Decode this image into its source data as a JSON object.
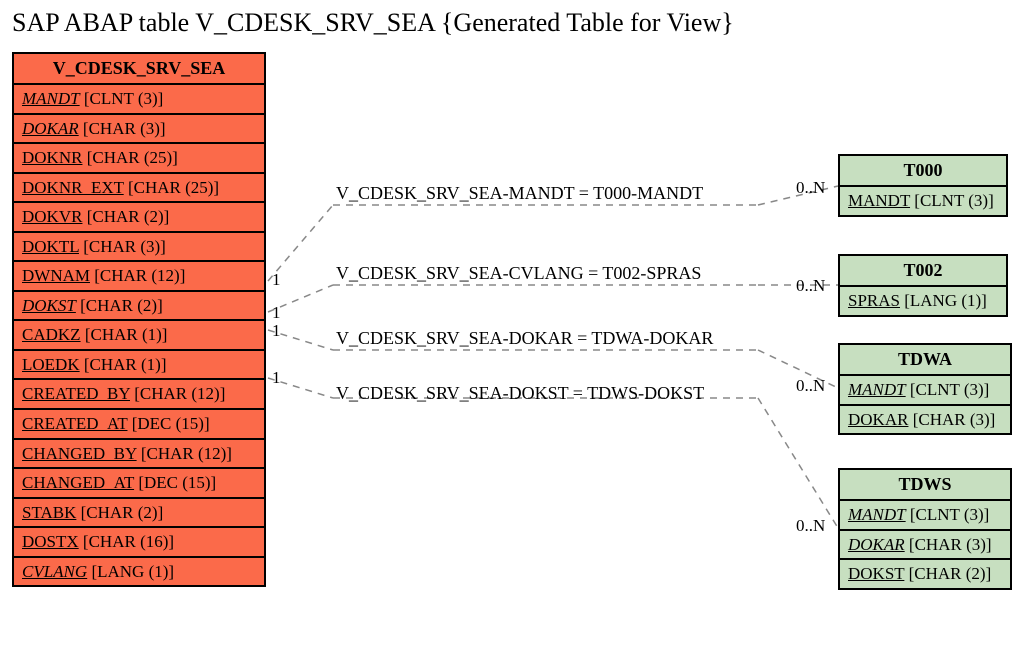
{
  "title": "SAP ABAP table V_CDESK_SRV_SEA {Generated Table for View}",
  "main_entity": {
    "name": "V_CDESK_SRV_SEA",
    "fields": [
      {
        "name": "MANDT",
        "type": "[CLNT (3)]",
        "key": true
      },
      {
        "name": "DOKAR",
        "type": "[CHAR (3)]",
        "key": true
      },
      {
        "name": "DOKNR",
        "type": "[CHAR (25)]",
        "key": false
      },
      {
        "name": "DOKNR_EXT",
        "type": "[CHAR (25)]",
        "key": false
      },
      {
        "name": "DOKVR",
        "type": "[CHAR (2)]",
        "key": false
      },
      {
        "name": "DOKTL",
        "type": "[CHAR (3)]",
        "key": false
      },
      {
        "name": "DWNAM",
        "type": "[CHAR (12)]",
        "key": false
      },
      {
        "name": "DOKST",
        "type": "[CHAR (2)]",
        "key": true
      },
      {
        "name": "CADKZ",
        "type": "[CHAR (1)]",
        "key": false
      },
      {
        "name": "LOEDK",
        "type": "[CHAR (1)]",
        "key": false
      },
      {
        "name": "CREATED_BY",
        "type": "[CHAR (12)]",
        "key": false
      },
      {
        "name": "CREATED_AT",
        "type": "[DEC (15)]",
        "key": false
      },
      {
        "name": "CHANGED_BY",
        "type": "[CHAR (12)]",
        "key": false
      },
      {
        "name": "CHANGED_AT",
        "type": "[DEC (15)]",
        "key": false
      },
      {
        "name": "STABK",
        "type": "[CHAR (2)]",
        "key": false
      },
      {
        "name": "DOSTX",
        "type": "[CHAR (16)]",
        "key": false
      },
      {
        "name": "CVLANG",
        "type": "[LANG (1)]",
        "key": true
      }
    ]
  },
  "ref_entities": [
    {
      "name": "T000",
      "fields": [
        {
          "name": "MANDT",
          "type": "[CLNT (3)]",
          "key": false
        }
      ]
    },
    {
      "name": "T002",
      "fields": [
        {
          "name": "SPRAS",
          "type": "[LANG (1)]",
          "key": false
        }
      ]
    },
    {
      "name": "TDWA",
      "fields": [
        {
          "name": "MANDT",
          "type": "[CLNT (3)]",
          "key": true
        },
        {
          "name": "DOKAR",
          "type": "[CHAR (3)]",
          "key": false
        }
      ]
    },
    {
      "name": "TDWS",
      "fields": [
        {
          "name": "MANDT",
          "type": "[CLNT (3)]",
          "key": true
        },
        {
          "name": "DOKAR",
          "type": "[CHAR (3)]",
          "key": true
        },
        {
          "name": "DOKST",
          "type": "[CHAR (2)]",
          "key": false
        }
      ]
    }
  ],
  "relations": [
    {
      "label": "V_CDESK_SRV_SEA-MANDT = T000-MANDT",
      "left_card": "1",
      "right_card": "0..N"
    },
    {
      "label": "V_CDESK_SRV_SEA-CVLANG = T002-SPRAS",
      "left_card": "1",
      "right_card": "0..N"
    },
    {
      "label": "V_CDESK_SRV_SEA-DOKAR = TDWA-DOKAR",
      "left_card": "1",
      "right_card": "0..N"
    },
    {
      "label": "V_CDESK_SRV_SEA-DOKST = TDWS-DOKST",
      "left_card": "1",
      "right_card": "0..N"
    }
  ]
}
